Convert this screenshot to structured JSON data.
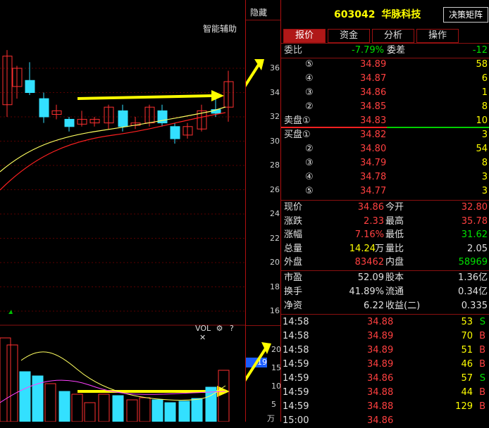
{
  "toolbar": {
    "hide_label": "隐藏",
    "smart_assist": "智能辅助"
  },
  "stock": {
    "code": "603042",
    "name": "华脉科技",
    "decision_button": "决策矩阵"
  },
  "tabs": [
    "报价",
    "资金",
    "分析",
    "操作"
  ],
  "weibi": {
    "label": "委比",
    "value": "-7.79%",
    "diff_label": "委差",
    "diff": "-12"
  },
  "asks": [
    {
      "level": "⑤",
      "price": "34.89",
      "vol": "58"
    },
    {
      "level": "④",
      "price": "34.87",
      "vol": "6"
    },
    {
      "level": "③",
      "price": "34.86",
      "vol": "1"
    },
    {
      "level": "②",
      "price": "34.85",
      "vol": "8"
    },
    {
      "level": "卖盘①",
      "price": "34.83",
      "vol": "10"
    }
  ],
  "bids": [
    {
      "level": "买盘①",
      "price": "34.82",
      "vol": "3"
    },
    {
      "level": "②",
      "price": "34.80",
      "vol": "54"
    },
    {
      "level": "③",
      "price": "34.79",
      "vol": "8"
    },
    {
      "level": "④",
      "price": "34.78",
      "vol": "3"
    },
    {
      "level": "⑤",
      "price": "34.77",
      "vol": "3"
    }
  ],
  "quote": {
    "price_label": "现价",
    "price": "34.86",
    "open_label": "今开",
    "open": "32.80",
    "chg_label": "涨跌",
    "chg": "2.33",
    "high_label": "最高",
    "high": "35.78",
    "pct_label": "涨幅",
    "pct": "7.16%",
    "low_label": "最低",
    "low": "31.62",
    "vol_label": "总量",
    "vol_num": "14.24",
    "vol_unit": "万",
    "vr_label": "量比",
    "vr": "2.05",
    "outer_label": "外盘",
    "outer": "83462",
    "inner_label": "内盘",
    "inner": "58969",
    "pe_label": "市盈",
    "pe": "52.09",
    "cap_label": "股本",
    "cap": "1.36亿",
    "turn_label": "换手",
    "turn": "41.89%",
    "float_label": "流通",
    "float": "0.34亿",
    "nav_label": "净资",
    "nav": "6.22",
    "eps_label": "收益(二)",
    "eps": "0.335"
  },
  "ticks": [
    {
      "time": "14:58",
      "price": "34.88",
      "vol": "53",
      "side": "S"
    },
    {
      "time": "14:58",
      "price": "34.89",
      "vol": "70",
      "side": "B"
    },
    {
      "time": "14:58",
      "price": "34.89",
      "vol": "51",
      "side": "B"
    },
    {
      "time": "14:59",
      "price": "34.89",
      "vol": "46",
      "side": "B"
    },
    {
      "time": "14:59",
      "price": "34.86",
      "vol": "57",
      "side": "S"
    },
    {
      "time": "14:59",
      "price": "34.88",
      "vol": "44",
      "side": "B"
    },
    {
      "time": "14:59",
      "price": "34.88",
      "vol": "129",
      "side": "B"
    },
    {
      "time": "15:00",
      "price": "34.86",
      "vol": "",
      "side": ""
    }
  ],
  "price_axis": [
    "36",
    "34",
    "32",
    "30",
    "28",
    "26",
    "24",
    "22",
    "20",
    "18",
    "16"
  ],
  "vol_axis": [
    "20",
    "15",
    "10",
    "5"
  ],
  "vol_panel": {
    "label": "VOL",
    "gear": "⚙",
    "help": "?",
    "close": "✕",
    "highlight": "19",
    "unit": "万"
  },
  "colors": {
    "up": "#ff3030",
    "down": "#33e0ff",
    "ma5": "#ffff60",
    "ma10": "#ff2020",
    "arrow": "#ffff00"
  }
}
